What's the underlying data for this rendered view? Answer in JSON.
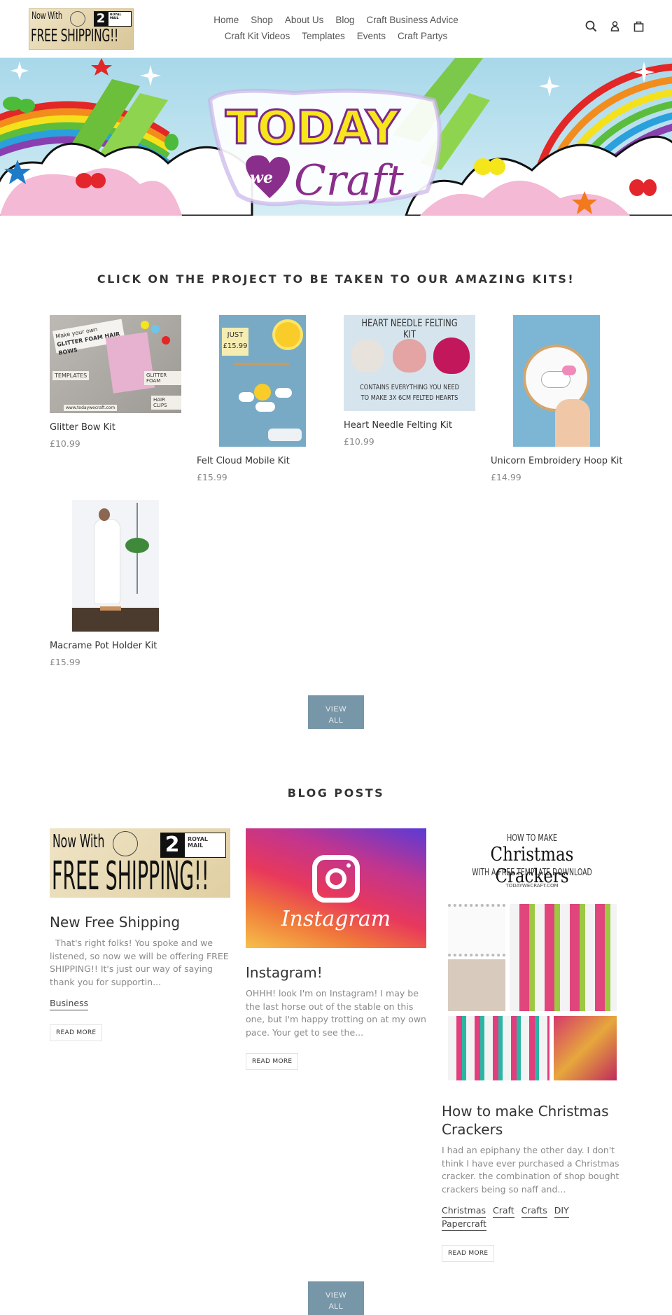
{
  "header": {
    "logo": {
      "line1": "Now With",
      "line2": "FREE SHIPPING!!",
      "badge_number": "2",
      "badge_text": "ROYAL MAIL"
    },
    "nav_row1": [
      "Home",
      "Shop",
      "About Us",
      "Blog",
      "Craft Business Advice"
    ],
    "nav_row2": [
      "Craft Kit Videos",
      "Templates",
      "Events",
      "Craft Partys"
    ],
    "icons": [
      "search-icon",
      "account-icon",
      "cart-icon"
    ]
  },
  "hero": {
    "title_top": "TODAY",
    "title_mid": "we",
    "title_bottom": "Craft"
  },
  "products_section": {
    "title": "CLICK ON THE PROJECT TO BE TAKEN TO OUR AMAZING KITS!",
    "items": [
      {
        "name": "Glitter Bow Kit",
        "price": "£10.99",
        "image_text": [
          "Make your own",
          "GLITTER FOAM HAIR BOWS",
          "TEMPLATES",
          "GLITTER FOAM",
          "HAIR CLIPS",
          "www.todaywecraft.com"
        ]
      },
      {
        "name": "Felt Cloud Mobile Kit",
        "price": "£15.99",
        "image_text": [
          "JUST",
          "£15.99"
        ]
      },
      {
        "name": "Heart Needle Felting Kit",
        "price": "£10.99",
        "image_text": [
          "HEART NEEDLE FELTING KIT",
          "CONTAINS EVERYTHING YOU NEED",
          "TO MAKE 3X 6CM FELTED HEARTS"
        ]
      },
      {
        "name": "Unicorn Embroidery Hoop Kit",
        "price": "£14.99"
      },
      {
        "name": "Macrame Pot Holder Kit",
        "price": "£15.99"
      }
    ],
    "view_all_line1": "VIEW",
    "view_all_line2": "ALL"
  },
  "blog_section": {
    "title": "BLOG POSTS",
    "posts": [
      {
        "title": "New Free Shipping",
        "excerpt": "  That's right folks! You spoke and we listened, so now we will be offering FREE SHIPPING!! It's just our way of saying thank you for supportin...",
        "tags": [
          "Business"
        ],
        "read_more": "READ MORE",
        "image_text": [
          "Now With",
          "FREE SHIPPING!!",
          "2",
          "ROYAL MAIL"
        ]
      },
      {
        "title": "Instagram!",
        "excerpt": "OHHH! look I'm on Instagram! I may be the last horse out of the stable on this one, but I'm happy trotting on at my own pace. Your get to see the...",
        "tags": [],
        "read_more": "READ MORE",
        "image_text": [
          "Instagram"
        ]
      },
      {
        "title": "How to make Christmas Crackers",
        "excerpt": "I had an epiphany the other day. I don't think I have ever purchased a Christmas cracker. the combination of shop bought crackers being so naff and...",
        "tags": [
          "Christmas",
          "Craft",
          "Crafts",
          "DIY",
          "Papercraft"
        ],
        "read_more": "READ MORE",
        "image_text": [
          "HOW TO MAKE",
          "Christmas Crackers",
          "WITH A FREE TEMPLATE DOWNLOAD",
          "TODAYWECRAFT.COM"
        ]
      }
    ],
    "view_all_line1": "VIEW",
    "view_all_line2": "ALL"
  },
  "colors": {
    "button": "#7796a8",
    "text": "#333333",
    "muted": "#888888"
  }
}
